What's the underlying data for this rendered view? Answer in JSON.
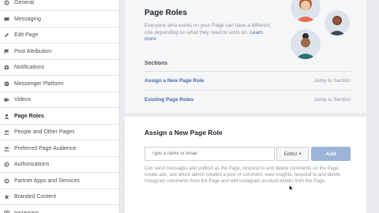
{
  "sidebar": {
    "items": [
      {
        "label": "General",
        "icon": "gear-icon"
      },
      {
        "label": "Messaging",
        "icon": "chat-icon"
      },
      {
        "label": "Edit Page",
        "icon": "pencil-icon"
      },
      {
        "label": "Post Attribution",
        "icon": "flag-icon"
      },
      {
        "label": "Notifications",
        "icon": "globe-icon"
      },
      {
        "label": "Messenger Platform",
        "icon": "messenger-icon"
      },
      {
        "label": "Videos",
        "icon": "video-icon"
      },
      {
        "label": "Page Roles",
        "icon": "person-icon",
        "active": true
      },
      {
        "label": "People and Other Pages",
        "icon": "people-icon"
      },
      {
        "label": "Preferred Page Audience",
        "icon": "people-icon"
      },
      {
        "label": "Authorizations",
        "icon": "gear-icon"
      },
      {
        "label": "Partner Apps and Services",
        "icon": "gear-icon"
      },
      {
        "label": "Branded Content",
        "icon": "star-icon"
      },
      {
        "label": "Instagram",
        "icon": "instagram-icon"
      }
    ]
  },
  "header": {
    "title": "Page Roles",
    "description": "Everyone who works on your Page can have a different role depending on what they need to work on.",
    "learn_more": "Learn more"
  },
  "sections": {
    "label": "Sections",
    "rows": [
      {
        "name": "Assign a New Page Role",
        "jump": "Jump to Section"
      },
      {
        "name": "Existing Page Roles",
        "jump": "Jump to Section"
      }
    ]
  },
  "assign": {
    "title": "Assign a New Page Role",
    "input_placeholder": "Type a name or email",
    "role_value": "Editor",
    "role_caret": "♦",
    "add_label": "Add",
    "help": "Can send messages and publish as the Page, respond to and delete comments on the Page, create ads, see which admin created a post or comment, view insights, respond to and delete Instagram comments from the Page and edit Instagram account details from the Page."
  },
  "colors": {
    "link": "#4267b2",
    "add_button": "#9cb4d8",
    "avatar_bg": "#dde3ea"
  }
}
